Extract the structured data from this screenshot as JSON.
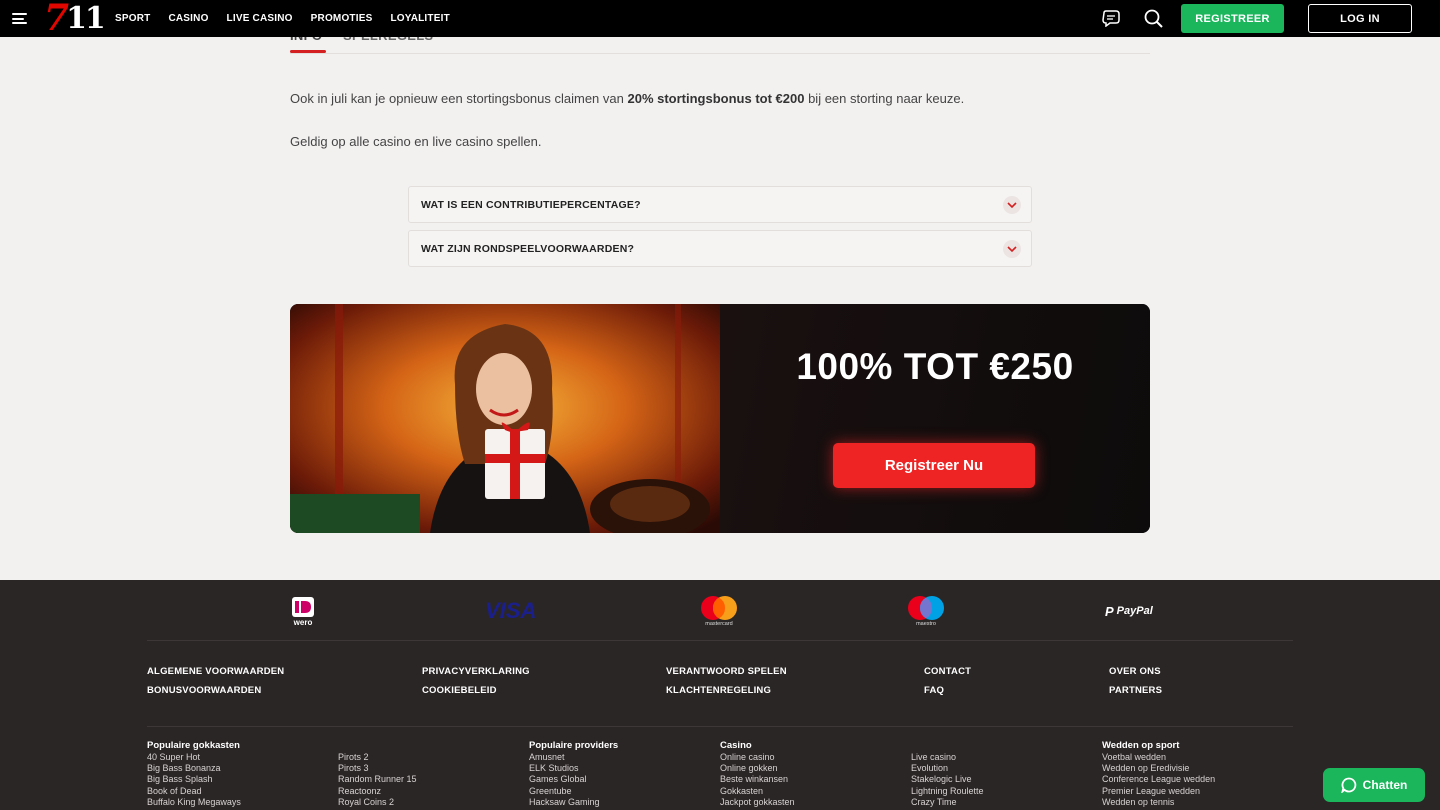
{
  "header": {
    "logo_seven": "7",
    "logo_eleven": "11",
    "nav": [
      "SPORT",
      "CASINO",
      "LIVE CASINO",
      "PROMOTIES",
      "LOYALITEIT"
    ],
    "register_label": "REGISTREER",
    "login_label": "LOG IN"
  },
  "tabs": {
    "info": "INFO",
    "rules": "SPELREGELS"
  },
  "content": {
    "p1_before": "Ook in juli kan je opnieuw een stortingsbonus claimen van ",
    "p1_bold": "20% stortingsbonus tot €200",
    "p1_after": " bij een storting naar keuze.",
    "p2": "Geldig op alle casino en live casino spellen."
  },
  "faq": [
    {
      "question": "WAT IS EEN CONTRIBUTIEPERCENTAGE?"
    },
    {
      "question": "WAT ZIJN RONDSPEELVOORWAARDEN?"
    }
  ],
  "banner": {
    "title": "100% TOT €250",
    "cta": "Registreer Nu"
  },
  "payments": {
    "wero": "wero",
    "visa": "VISA",
    "mastercard": "mastercard",
    "maestro": "maestro",
    "paypal": "PayPal"
  },
  "footer_links": {
    "algemene": "ALGEMENE VOORWAARDEN",
    "bonus": "BONUSVOORWAARDEN",
    "privacy": "PRIVACYVERKLARING",
    "cookie": "COOKIEBELEID",
    "verantwoord": "VERANTWOORD SPELEN",
    "klachten": "KLACHTENREGELING",
    "contact": "CONTACT",
    "faq": "FAQ",
    "over": "OVER ONS",
    "partners": "PARTNERS"
  },
  "columns": {
    "gokkasten": {
      "title": "Populaire gokkasten",
      "items": [
        "40 Super Hot",
        "Big Bass Bonanza",
        "Big Bass Splash",
        "Book of Dead",
        "Buffalo King Megaways"
      ]
    },
    "gokkasten2": {
      "items": [
        "Pirots 2",
        "Pirots 3",
        "Random Runner 15",
        "Reactoonz",
        "Royal Coins 2"
      ]
    },
    "providers": {
      "title": "Populaire providers",
      "items": [
        "Amusnet",
        "ELK Studios",
        "Games Global",
        "Greentube",
        "Hacksaw Gaming"
      ]
    },
    "casino": {
      "title": "Casino",
      "items": [
        "Online casino",
        "Online gokken",
        "Beste winkansen",
        "Gokkasten",
        "Jackpot gokkasten"
      ]
    },
    "casino2": {
      "items": [
        "Live casino",
        "Evolution",
        "Stakelogic Live",
        "Lightning Roulette",
        "Crazy Time"
      ]
    },
    "sport": {
      "title": "Wedden op sport",
      "items": [
        "Voetbal wedden",
        "Wedden op Eredivisie",
        "Conference League wedden",
        "Premier League wedden",
        "Wedden op tennis"
      ]
    }
  },
  "chat": {
    "label": "Chatten"
  },
  "colors": {
    "accent_green": "#1bb55c",
    "accent_red": "#ee2424",
    "footer_bg": "#2b2626"
  }
}
